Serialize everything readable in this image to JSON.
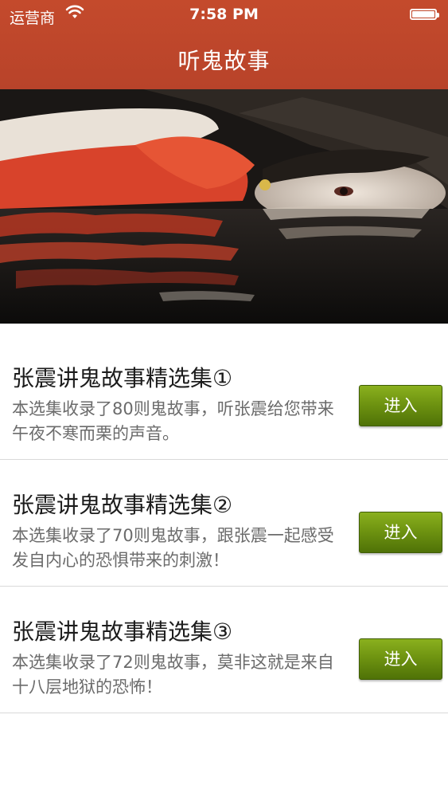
{
  "status_bar": {
    "carrier": "运营商",
    "time": "7:58 PM"
  },
  "nav": {
    "title": "听鬼故事"
  },
  "banner": {
    "image": "ghost-woman-in-water"
  },
  "collections": [
    {
      "title": "张震讲鬼故事精选集①",
      "description": "本选集收录了80则鬼故事，听张震给您带来午夜不寒而栗的声音。",
      "button_label": "进入"
    },
    {
      "title": "张震讲鬼故事精选集②",
      "description": "本选集收录了70则鬼故事，跟张震一起感受发自内心的恐惧带来的刺激！",
      "button_label": "进入"
    },
    {
      "title": "张震讲鬼故事精选集③",
      "description": "本选集收录了72则鬼故事，莫非这就是来自十八层地狱的恐怖！",
      "button_label": "进入"
    }
  ],
  "colors": {
    "nav_bar": "#c44a2c",
    "button": "#6f9411"
  }
}
